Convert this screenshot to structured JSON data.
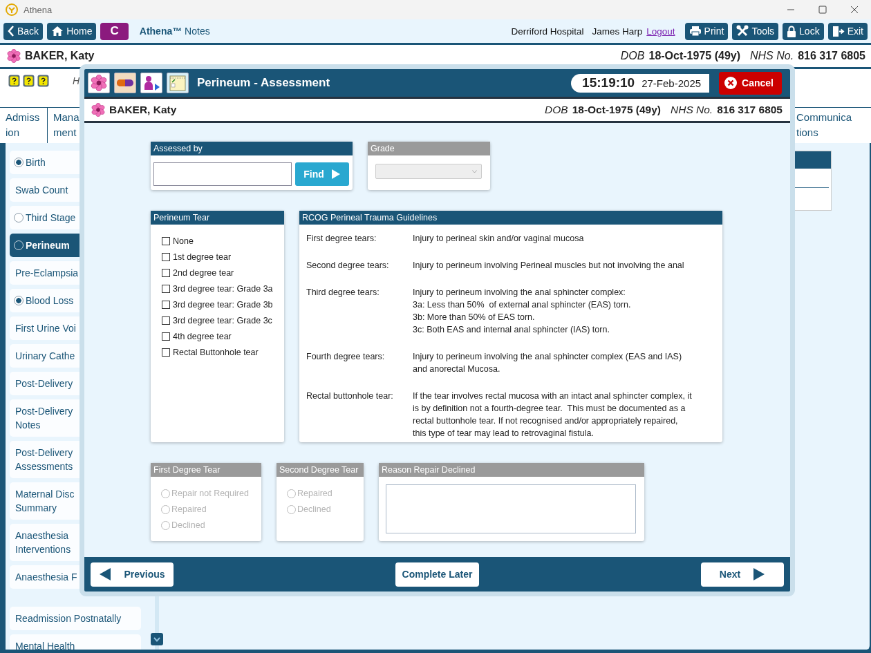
{
  "app": {
    "title": "Athena"
  },
  "toolbar": {
    "nav": [
      {
        "kind": "back",
        "label": "Back"
      },
      {
        "kind": "home",
        "label": "Home"
      },
      {
        "kind": "badge",
        "label": "C"
      }
    ],
    "app_name": "**Athena™** Notes",
    "hospital": "Derriford Hospital",
    "user": "James Harp",
    "logout": "Logout",
    "actions": [
      {
        "kind": "print",
        "label": "Print"
      },
      {
        "kind": "tools",
        "label": "Tools"
      },
      {
        "kind": "lock",
        "label": "Lock"
      },
      {
        "kind": "exit",
        "label": "Exit"
      }
    ]
  },
  "patient": {
    "name": "BAKER, Katy",
    "dob_label": "DOB",
    "dob": "18-Oct-1975 (49y)",
    "nhs_label": "NHS No.",
    "nhs": "816 317 6805"
  },
  "alerts": {
    "note": "H"
  },
  "tabs": [
    {
      "label": "Admiss\nion"
    },
    {
      "label": "Mana\nment"
    },
    {
      "label": "Communica\ntions"
    }
  ],
  "sidebar": {
    "items": [
      {
        "label": "Birth",
        "kind": "radio",
        "checked": true,
        "selected": false
      },
      {
        "label": "Swab Count",
        "selected": false
      },
      {
        "label": "Third Stage",
        "kind": "radio",
        "checked": false,
        "selected": false
      },
      {
        "label": "Perineum",
        "kind": "radio",
        "checked": false,
        "selected": true
      },
      {
        "label": "Pre-Eclampsia",
        "selected": false
      },
      {
        "label": "Blood Loss",
        "kind": "radio",
        "checked": true,
        "selected": false
      },
      {
        "label": "First Urine Voi",
        "selected": false
      },
      {
        "label": "Urinary Cathe",
        "selected": false
      },
      {
        "label": "Post-Delivery",
        "selected": false
      },
      {
        "label": "Post-Delivery\nNotes",
        "selected": false
      },
      {
        "label": "Post-Delivery\nAssessments",
        "selected": false
      },
      {
        "label": "Maternal Disc\nSummary",
        "selected": false
      },
      {
        "label": "Anaesthesia\nInterventions",
        "selected": false
      },
      {
        "label": "Anaesthesia F",
        "selected": false
      },
      {
        "label": "Readmission Postnatally",
        "selected": false
      },
      {
        "label": "Mental Health",
        "selected": false
      }
    ]
  },
  "modal": {
    "title": "Perineum - Assessment",
    "time": "15:19:10",
    "date": "27-Feb-2025",
    "cancel": "Cancel",
    "patient": {
      "name": "BAKER, Katy",
      "dob_label": "DOB",
      "dob": "18-Oct-1975 (49y)",
      "nhs_label": "NHS No.",
      "nhs": "816 317 6805"
    },
    "assessed_by": {
      "title": "Assessed by",
      "find": "Find"
    },
    "grade": {
      "title": "Grade",
      "disabled": true
    },
    "tear": {
      "title": "Perineum Tear",
      "options": [
        {
          "label": "None",
          "checked": false
        },
        {
          "label": "1st degree tear",
          "checked": false
        },
        {
          "label": "2nd degree tear",
          "checked": false
        },
        {
          "label": "3rd degree tear: Grade 3a",
          "checked": false
        },
        {
          "label": "3rd degree tear: Grade 3b",
          "checked": false
        },
        {
          "label": "3rd degree tear: Grade 3c",
          "checked": false
        },
        {
          "label": "4th degree tear",
          "checked": false
        },
        {
          "label": "Rectal Buttonhole tear",
          "checked": false
        }
      ]
    },
    "guidelines": {
      "title": "RCOG Perineal Trauma Guidelines",
      "rows": [
        {
          "term": "First degree tears:",
          "text": "Injury to perineal skin and/or vaginal mucosa"
        },
        {
          "term": "Second degree tears:",
          "text": "Injury to perineum involving Perineal muscles but not involving the anal"
        },
        {
          "term": "Third degree tears:",
          "text": "Injury to perineum involving the anal sphincter complex:\n3a: Less than 50%  of external anal sphincter (EAS) torn.\n3b: More than 50% of EAS torn.\n3c: Both EAS and internal anal sphincter (IAS) torn."
        },
        {
          "term": "Fourth degree tears:",
          "text": "Injury to perineum involving the anal sphincter complex (EAS and IAS)\nand anorectal Mucosa."
        },
        {
          "term": "Rectal buttonhole tear:",
          "text": "If the tear involves rectal mucosa with an intact anal sphincter complex, it\nis by definition not a fourth-degree tear.  This must be documented as a\nrectal buttonhole tear. If not recognised and/or appropriately repaired,\nthis type of tear may lead to retrovaginal fistula."
        }
      ]
    },
    "repair": [
      {
        "title": "First Degree Tear",
        "disabled": true,
        "options": [
          {
            "label": "Repair not Required",
            "selected": false
          },
          {
            "label": "Repaired",
            "selected": false
          },
          {
            "label": "Declined",
            "selected": false
          }
        ]
      },
      {
        "title": "Second Degree Tear",
        "disabled": true,
        "options": [
          {
            "label": "Repaired",
            "selected": false
          },
          {
            "label": "Declined",
            "selected": false
          }
        ]
      }
    ],
    "reason": {
      "title": "Reason Repair Declined",
      "disabled": true
    },
    "footer": {
      "previous": "Previous",
      "complete_later": "Complete Later",
      "next": "Next"
    }
  }
}
